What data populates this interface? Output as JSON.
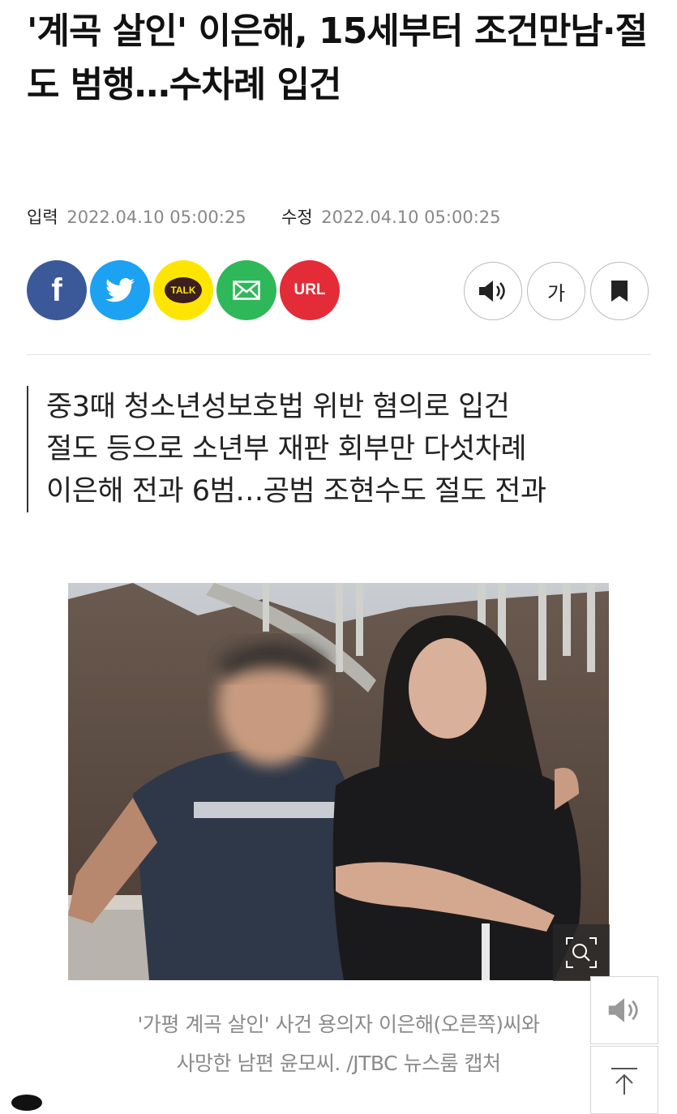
{
  "article": {
    "headline": "'계곡 살인' 이은해, 15세부터 조건만남·절도 범행…수차례 입건",
    "input_label": "입력",
    "input_time": "2022.04.10 05:00:25",
    "modified_label": "수정",
    "modified_time": "2022.04.10 05:00:25"
  },
  "share": [
    {
      "name": "facebook",
      "label": "f",
      "color": "#3b5998"
    },
    {
      "name": "twitter",
      "label": "",
      "color": "#1da1f2"
    },
    {
      "name": "kakaotalk",
      "label": "TALK",
      "color": "#fee500"
    },
    {
      "name": "email",
      "label": "",
      "color": "#2fb85a"
    },
    {
      "name": "url",
      "label": "URL",
      "color": "#e32c37"
    }
  ],
  "tools": {
    "font_size_label": "가"
  },
  "summary": [
    "중3때 청소년성보호법 위반 혐의로 입건",
    "절도 등으로 소년부 재판 회부만 다섯차례",
    "이은해 전과 6범…공범 조현수도 절도 전과"
  ],
  "photo": {
    "caption_line1": "'가평 계곡 살인' 사건 용의자 이은해(오른쪽)씨와",
    "caption_line2": "사망한 남편 윤모씨. /JTBC 뉴스룸 캡처"
  },
  "icons": {
    "speaker": "speaker-icon",
    "bookmark": "bookmark-icon",
    "zoom": "zoom-icon",
    "scroll_top": "arrow-up-icon"
  }
}
